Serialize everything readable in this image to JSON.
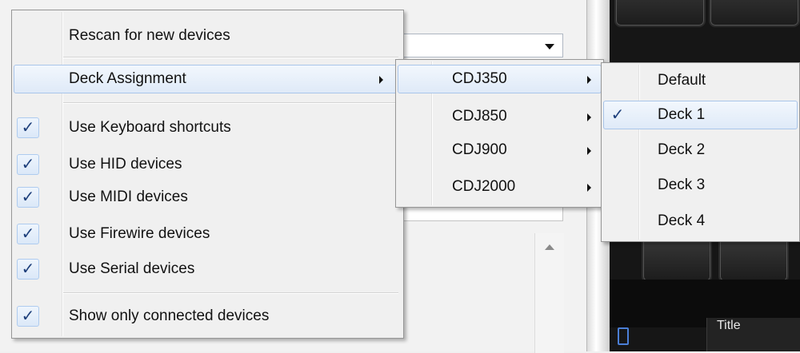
{
  "background": {
    "dark_panel_title": "Title"
  },
  "main_menu": {
    "items": [
      {
        "label": "Rescan for new devices",
        "checked": false,
        "submenu": false
      },
      {
        "label": "Deck Assignment",
        "checked": false,
        "submenu": true,
        "highlighted": true
      },
      {
        "label": "Use Keyboard shortcuts",
        "checked": true
      },
      {
        "label": "Use HID devices",
        "checked": true
      },
      {
        "label": "Use MIDI devices",
        "checked": true
      },
      {
        "label": "Use Firewire devices",
        "checked": true
      },
      {
        "label": "Use Serial devices",
        "checked": true
      },
      {
        "label": "Show only connected devices",
        "checked": true
      }
    ]
  },
  "cdj_menu": {
    "items": [
      {
        "label": "CDJ350",
        "highlighted": true
      },
      {
        "label": "CDJ850"
      },
      {
        "label": "CDJ900"
      },
      {
        "label": "CDJ2000"
      }
    ]
  },
  "deck_menu": {
    "items": [
      {
        "label": "Default",
        "checked": false
      },
      {
        "label": "Deck 1",
        "checked": true,
        "highlighted": true
      },
      {
        "label": "Deck 2",
        "checked": false
      },
      {
        "label": "Deck 3",
        "checked": false
      },
      {
        "label": "Deck 4",
        "checked": false
      }
    ]
  },
  "icons": {
    "check": "✓",
    "submenu": "chevron-right-icon"
  },
  "colors": {
    "highlight_border": "#a9c5ea",
    "check_color": "#1e3f7b"
  }
}
